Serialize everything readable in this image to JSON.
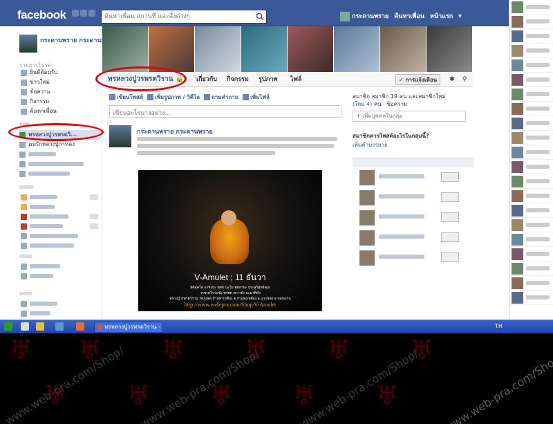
{
  "header": {
    "logo": "facebook",
    "search_placeholder": "ค้นหาเพื่อน สถานที่ และสิ่งต่างๆ",
    "profile_link": "กระดานพราย",
    "find_friends": "ค้นหาเพื่อน",
    "home": "หน้าแรก"
  },
  "sidebar": {
    "profile_name": "กระดานพราย กระดานพราย",
    "favorites_heading": "รายการโปรด",
    "favorites": [
      {
        "label": "ยินดีต้อนรับ",
        "icon": "welcome-icon"
      },
      {
        "label": "ข่าวใหม่",
        "icon": "news-feed-icon"
      },
      {
        "label": "ข้อความ",
        "icon": "messages-icon"
      },
      {
        "label": "กิจกรรม",
        "icon": "events-icon"
      },
      {
        "label": "ค้นหาเพื่อน",
        "icon": "find-friends-icon"
      }
    ],
    "groups_heading": "กลุ่ม",
    "selected_group": "พรหลวงปู่วรพรตวิ...",
    "group_item_2": "คนรักหลวงปู่กาหลง"
  },
  "group": {
    "tabs": [
      "พรหลวงปู่วรพรตวิราน",
      "เกี่ยวกับ",
      "กิจกรรม",
      "รูปภาพ",
      "ไฟล์"
    ],
    "notifications_button": "การแจ้งเตือน",
    "composer_actions": [
      "เขียนโพสต์",
      "เพิ่มรูปภาพ / วิดีโอ",
      "ถามคำถาม",
      "เพิ่มไฟล์"
    ],
    "composer_placeholder": "เขียนอะไรบางอย่าง..."
  },
  "post": {
    "author": "กระดานพราย กระดานพราย",
    "image_title": "V-Amulet ; 11 ธันวา",
    "image_lines": [
      "อิติสุคโต อรหังปะ พุทธิ นะโม พุทธายะ ประสุวิสุทธิคุณ",
      "วรพรตวิรานขัง พรพต เทวาขัง นะมาพิทัง",
      "หลวงปู่วรพรตวิราน วัดภูเพพ บ้านท่าเหลือง ต.กำแพงเหลือง อ.แวงน้อย จ.ขอนแก่น"
    ],
    "image_url": "http://www.web-pra.com/Shop/V-Amulet"
  },
  "right_column": {
    "members_line1": "สมาชิก สมาชิก 19 คน และสมาชิกใหม่",
    "members_new": "(ใหม่ 4)",
    "members_suffix": "คน · ข้อความ",
    "add_people": "+ เพิ่มบุคคลในกลุ่ม",
    "question": "สมาชิกควรโพสต์อะไรในกลุ่มนี้?",
    "add_description": "เพิ่มคำบรรยาย"
  },
  "taskbar": {
    "active_window": "พรหลวงปู่วรพรตวิราน - ...",
    "language": "TH"
  },
  "watermark": {
    "text": "www.web-pra.com/Shop/",
    "text_last": "www.web-pra.com/Shop/V-Amulet"
  },
  "colors": {
    "facebook_blue": "#3b5998",
    "highlight_ring": "#e00010",
    "taskbar": "#1e45a8"
  }
}
